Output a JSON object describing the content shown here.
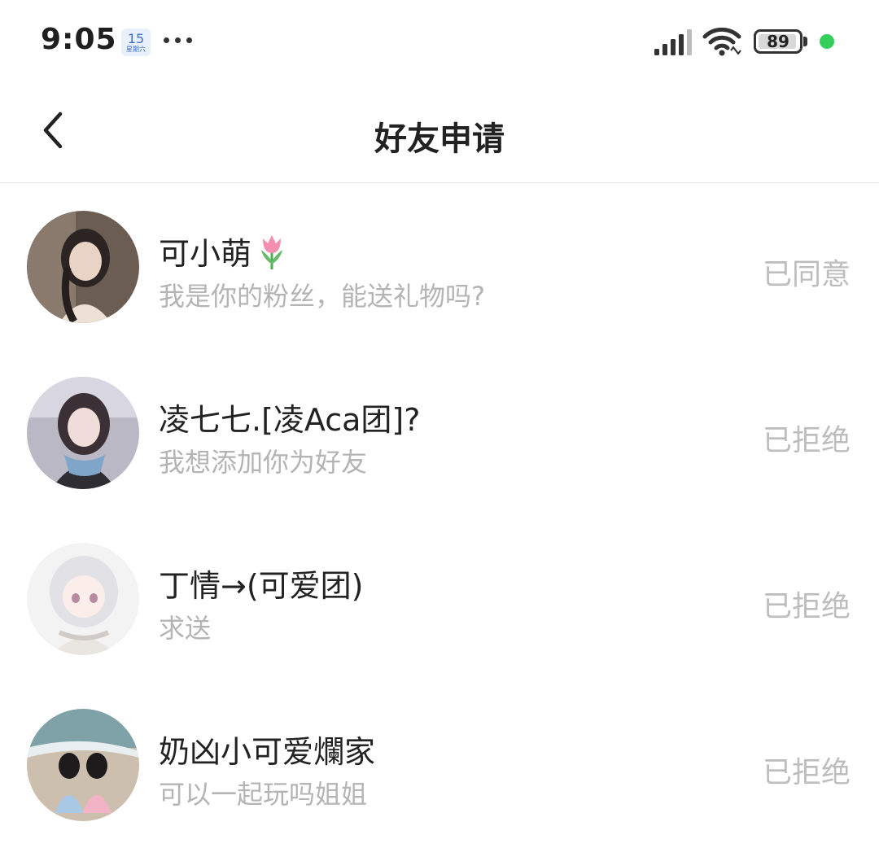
{
  "status_bar": {
    "time": "9:05",
    "calendar_day": "15",
    "calendar_week": "星期六",
    "battery": "89"
  },
  "header": {
    "title": "好友申请"
  },
  "requests": [
    {
      "name": "可小萌",
      "emoji": "tulip",
      "message": "我是你的粉丝，能送礼物吗?",
      "status": "已同意"
    },
    {
      "name": "凌七七.[凌Aca团]?",
      "message": "我想添加你为好友",
      "status": "已拒绝"
    },
    {
      "name": "丁情→(可爱团)",
      "message": "求送",
      "status": "已拒绝"
    },
    {
      "name": "奶凶小可爱爛家",
      "message": "可以一起玩吗姐姐",
      "status": "已拒绝"
    }
  ],
  "colors": {
    "accent_green": "#35d05c",
    "muted_text": "#b4b4b4",
    "status_text": "#bdbdbd"
  }
}
